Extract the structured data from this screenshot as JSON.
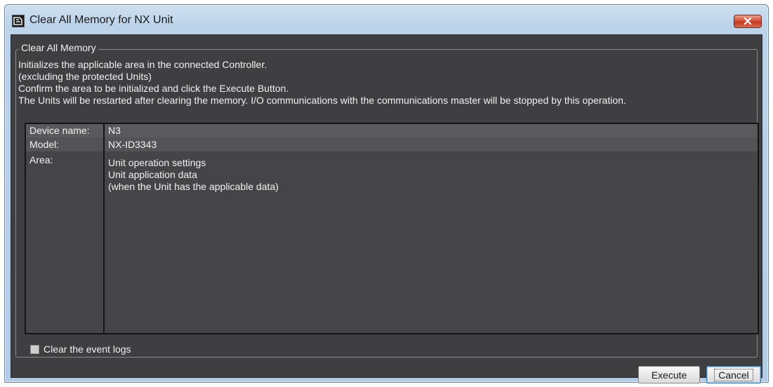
{
  "window": {
    "title": "Clear All Memory for NX Unit"
  },
  "group": {
    "label": "Clear All Memory",
    "description": [
      "Initializes the applicable area in the connected Controller.",
      "(excluding the protected Units)",
      "Confirm the area to be initialized and click the Execute Button.",
      "The Units will be restarted after clearing the memory. I/O communications with the communications master will be stopped by this operation."
    ]
  },
  "info": {
    "device_name_label": "Device name:",
    "device_name_value": "N3",
    "model_label": "Model:",
    "model_value": "NX-ID3343",
    "area_label": "Area:",
    "area_values": [
      "Unit operation settings",
      "Unit application data",
      "(when the Unit has the applicable data)"
    ]
  },
  "options": {
    "clear_event_logs_label": "Clear the event logs",
    "clear_event_logs_checked": false
  },
  "buttons": {
    "execute_label": "Execute",
    "cancel_label": "Cancel"
  },
  "colors": {
    "client_bg": "#3f3f41",
    "title_bar": "#bcd3ea",
    "close_button": "#c23a22"
  },
  "icons": {
    "app": "app-logo-icon",
    "close": "close-icon"
  }
}
